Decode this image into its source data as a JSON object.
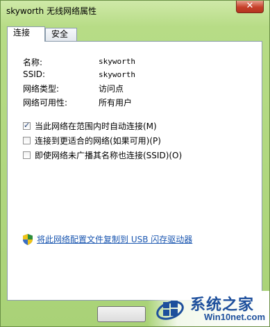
{
  "window": {
    "title": "skyworth 无线网络属性",
    "close_glyph": "✕"
  },
  "tabs": [
    {
      "label": "连接",
      "active": true
    },
    {
      "label": "安全",
      "active": false
    }
  ],
  "properties": [
    {
      "label": "名称:",
      "value": "skyworth"
    },
    {
      "label": "SSID:",
      "value": "skyworth"
    },
    {
      "label": "网络类型:",
      "value": "访问点"
    },
    {
      "label": "网络可用性:",
      "value": "所有用户"
    }
  ],
  "options": [
    {
      "label": "当此网络在范围内时自动连接(M)",
      "checked": true
    },
    {
      "label": "连接到更适合的网络(如果可用)(P)",
      "checked": false
    },
    {
      "label": "即使网络未广播其名称也连接(SSID)(O)",
      "checked": false
    }
  ],
  "usb_link": {
    "icon": "uac-shield-icon",
    "text": "将此网络配置文件复制到 USB 闪存驱动器"
  },
  "watermark": {
    "text_cn": "系统之家",
    "url": "Win10net.com"
  },
  "colors": {
    "window_frame": "#a9d277",
    "link": "#1a56b0",
    "close_button": "#c6402a",
    "watermark": "#1d4f9c"
  }
}
